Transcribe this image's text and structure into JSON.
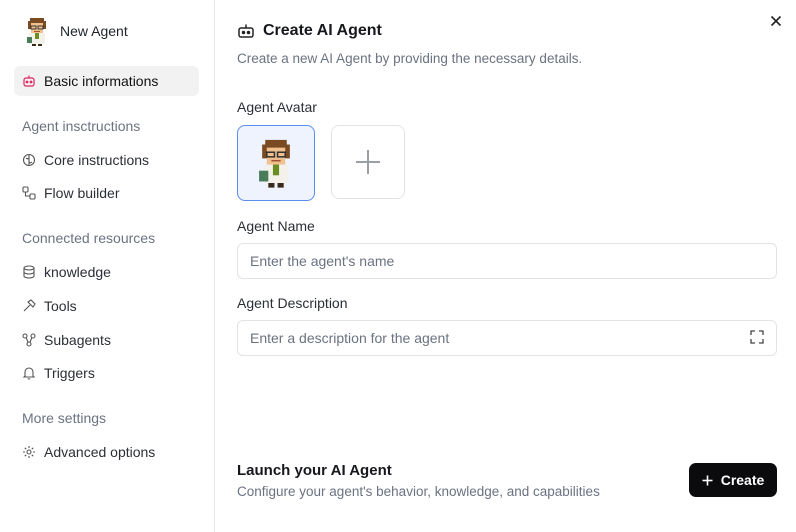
{
  "sidebar": {
    "agent_name": "New Agent",
    "agent_avatar_icon": "scientist-avatar-icon",
    "items": [
      {
        "label": "Basic informations",
        "icon": "bot-icon",
        "active": true
      },
      {
        "label": "Core instructions",
        "icon": "brain-icon"
      },
      {
        "label": "Flow builder",
        "icon": "flow-icon"
      },
      {
        "label": "knowledge",
        "icon": "database-icon"
      },
      {
        "label": "Tools",
        "icon": "hammer-icon"
      },
      {
        "label": "Subagents",
        "icon": "network-icon"
      },
      {
        "label": "Triggers",
        "icon": "bell-icon"
      },
      {
        "label": "Advanced options",
        "icon": "gear-icon"
      }
    ],
    "sections": {
      "instructions": "Agent insctructions",
      "resources": "Connected resources",
      "settings": "More settings"
    }
  },
  "header": {
    "title": "Create AI Agent",
    "subtitle": "Create a new AI Agent by providing the necessary details."
  },
  "form": {
    "avatar_label": "Agent Avatar",
    "name_label": "Agent Name",
    "name_placeholder": "Enter the agent's name",
    "name_value": "",
    "description_label": "Agent Description",
    "description_placeholder": "Enter a description for the agent",
    "description_value": ""
  },
  "footer": {
    "title": "Launch your AI Agent",
    "subtitle": "Configure your agent's behavior, knowledge, and capabilities",
    "create_label": "Create"
  },
  "colors": {
    "accent_border": "#5b8def",
    "primary_button": "#0b0b0d",
    "active_icon": "#e0245e"
  }
}
